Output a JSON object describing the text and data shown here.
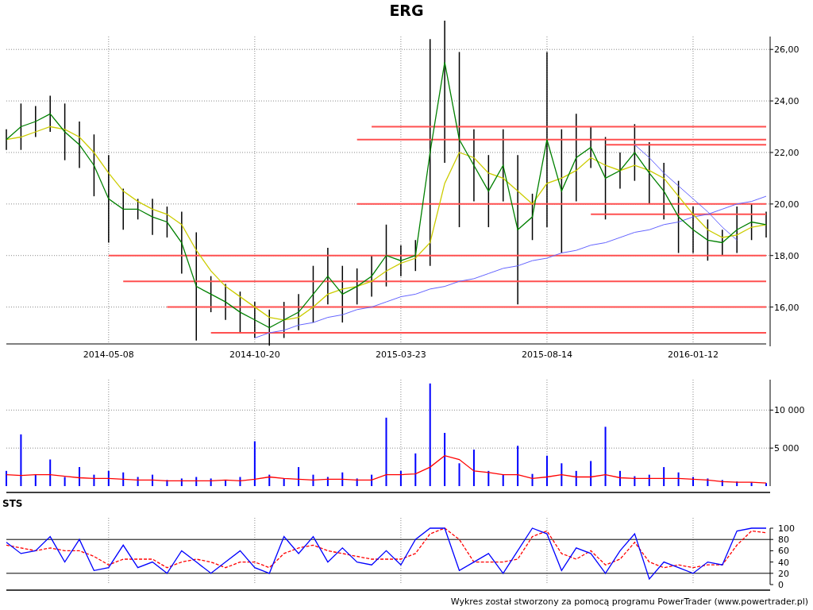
{
  "title": "ERG",
  "price_chart": {
    "chart_data": {
      "type": "line",
      "grid": true,
      "categories": [
        null,
        null,
        null,
        null,
        null,
        null,
        null,
        "2014-05-08",
        null,
        null,
        null,
        null,
        null,
        null,
        null,
        null,
        null,
        "2014-10-20",
        null,
        null,
        null,
        null,
        null,
        null,
        null,
        null,
        null,
        "2015-03-23",
        null,
        null,
        null,
        null,
        null,
        null,
        null,
        null,
        null,
        "2015-08-14",
        null,
        null,
        null,
        null,
        null,
        null,
        null,
        null,
        null,
        "2016-01-12",
        null,
        null,
        null,
        null,
        null
      ],
      "ylim": [
        14.6,
        26.5
      ],
      "yticks": [
        {
          "value": 16,
          "label": "16,00"
        },
        {
          "value": 18,
          "label": "18,00"
        },
        {
          "value": 20,
          "label": "20,00"
        },
        {
          "value": 22,
          "label": "22,00"
        },
        {
          "value": 24,
          "label": "24,00"
        },
        {
          "value": 26,
          "label": "26,00"
        }
      ],
      "series": [
        {
          "color": "#008000",
          "values": [
            22.5,
            23,
            23.2,
            23.5,
            22.8,
            22.3,
            21.5,
            20.2,
            19.8,
            19.8,
            19.5,
            19.3,
            18.5,
            16.8,
            16.5,
            16.2,
            15.8,
            15.5,
            15.2,
            15.5,
            15.8,
            16.5,
            17.2,
            16.5,
            16.8,
            17.2,
            18,
            17.8,
            18,
            22,
            25.5,
            22.5,
            21.5,
            20.5,
            21.5,
            19,
            19.5,
            22.5,
            20.5,
            21.8,
            22.2,
            21,
            21.3,
            22,
            21.2,
            20.5,
            19.5,
            19,
            18.6,
            18.5,
            19,
            19.3,
            19.2
          ],
          "errors": [
            0.4,
            0.9,
            0.6,
            0.7,
            1.1,
            0.9,
            1.2,
            1.7,
            0.8,
            0.4,
            0.7,
            0.6,
            1.2,
            2.1,
            0.7,
            0.7,
            0.8,
            0.7,
            0.7,
            0.7,
            0.7,
            1.1,
            1.1,
            1.1,
            0.7,
            0.8,
            1.2,
            0.6,
            0.6,
            4.4,
            3.9,
            3.4,
            1.4,
            1.4,
            1.4,
            2.9,
            0.9,
            3.4,
            2.4,
            1.7,
            0.8,
            1.6,
            0.7,
            1.1,
            1.2,
            1.1,
            1.4,
            0.9,
            0.8,
            0.5,
            0.9,
            0.7,
            0.5
          ]
        },
        {
          "color": "#cccc00",
          "values": [
            22.5,
            22.6,
            22.8,
            23,
            22.9,
            22.6,
            22,
            21.2,
            20.5,
            20.1,
            19.8,
            19.6,
            19.2,
            18.2,
            17.4,
            16.8,
            16.4,
            16,
            15.6,
            15.5,
            15.6,
            16,
            16.5,
            16.7,
            16.8,
            17,
            17.4,
            17.7,
            17.9,
            18.5,
            20.8,
            22,
            21.8,
            21.2,
            21,
            20.5,
            20,
            20.8,
            21,
            21.3,
            21.8,
            21.5,
            21.3,
            21.5,
            21.3,
            21,
            20.3,
            19.6,
            19,
            18.7,
            18.8,
            19.1,
            19.2
          ]
        },
        {
          "color": "#ff5050",
          "values": [
            null,
            null,
            null,
            null,
            null,
            null,
            null,
            null,
            null,
            null,
            null,
            null,
            null,
            null,
            null,
            null,
            null,
            null,
            null,
            null,
            null,
            null,
            null,
            null,
            null,
            23,
            23,
            23,
            23,
            23,
            23,
            23,
            23,
            23,
            23,
            23,
            23,
            23,
            23,
            23,
            23,
            23,
            23,
            23,
            23,
            23,
            23,
            23,
            23,
            23,
            23,
            23,
            23
          ]
        },
        {
          "color": "#ff5050",
          "values": [
            null,
            null,
            null,
            null,
            null,
            null,
            null,
            null,
            null,
            null,
            null,
            null,
            null,
            null,
            null,
            null,
            null,
            null,
            null,
            null,
            null,
            null,
            null,
            null,
            22.5,
            22.5,
            22.5,
            22.5,
            22.5,
            22.5,
            22.5,
            22.5,
            22.5,
            22.5,
            22.5,
            22.5,
            22.5,
            22.5,
            22.5,
            22.5,
            22.5,
            22.5,
            22.5,
            22.5,
            22.5,
            22.5,
            22.5,
            22.5,
            22.5,
            22.5,
            22.5,
            22.5,
            22.5
          ]
        },
        {
          "color": "#ff5050",
          "values": [
            null,
            null,
            null,
            null,
            null,
            null,
            null,
            null,
            null,
            null,
            null,
            null,
            null,
            null,
            null,
            null,
            null,
            null,
            null,
            null,
            null,
            null,
            null,
            null,
            null,
            null,
            null,
            null,
            null,
            null,
            null,
            null,
            null,
            null,
            null,
            null,
            null,
            null,
            null,
            null,
            null,
            22.3,
            22.3,
            22.3,
            22.3,
            22.3,
            22.3,
            22.3,
            22.3,
            22.3,
            22.3,
            22.3,
            22.3
          ]
        },
        {
          "color": "#ff5050",
          "values": [
            null,
            null,
            null,
            null,
            null,
            null,
            null,
            null,
            null,
            null,
            null,
            null,
            null,
            null,
            null,
            null,
            null,
            null,
            null,
            null,
            null,
            null,
            null,
            null,
            20,
            20,
            20,
            20,
            20,
            20,
            20,
            20,
            20,
            20,
            20,
            20,
            20,
            20,
            20,
            20,
            20,
            20,
            20,
            20,
            20,
            20,
            20,
            20,
            20,
            20,
            20,
            20,
            20
          ]
        },
        {
          "color": "#ff5050",
          "values": [
            null,
            null,
            null,
            null,
            null,
            null,
            null,
            null,
            null,
            null,
            null,
            null,
            null,
            null,
            null,
            null,
            null,
            null,
            null,
            null,
            null,
            null,
            null,
            null,
            null,
            null,
            null,
            null,
            null,
            null,
            null,
            null,
            null,
            null,
            null,
            null,
            null,
            null,
            null,
            null,
            19.6,
            19.6,
            19.6,
            19.6,
            19.6,
            19.6,
            19.6,
            19.6,
            19.6,
            19.6,
            19.6,
            19.6,
            19.6
          ]
        },
        {
          "color": "#ff5050",
          "values": [
            null,
            null,
            null,
            null,
            null,
            null,
            null,
            18,
            18,
            18,
            18,
            18,
            18,
            18,
            18,
            18,
            18,
            18,
            18,
            18,
            18,
            18,
            18,
            18,
            18,
            18,
            18,
            18,
            18,
            18,
            18,
            18,
            18,
            18,
            18,
            18,
            18,
            18,
            18,
            18,
            18,
            18,
            18,
            18,
            18,
            18,
            18,
            18,
            18,
            18,
            18,
            18,
            18
          ]
        },
        {
          "color": "#ff5050",
          "values": [
            null,
            null,
            null,
            null,
            null,
            null,
            null,
            null,
            17,
            17,
            17,
            17,
            17,
            17,
            17,
            17,
            17,
            17,
            17,
            17,
            17,
            17,
            17,
            17,
            17,
            17,
            17,
            17,
            17,
            17,
            17,
            17,
            17,
            17,
            17,
            17,
            17,
            17,
            17,
            17,
            17,
            17,
            17,
            17,
            17,
            17,
            17,
            17,
            17,
            17,
            17,
            17,
            17
          ]
        },
        {
          "color": "#ff5050",
          "values": [
            null,
            null,
            null,
            null,
            null,
            null,
            null,
            null,
            null,
            null,
            null,
            16,
            16,
            16,
            16,
            16,
            16,
            16,
            16,
            16,
            16,
            16,
            16,
            16,
            16,
            16,
            16,
            16,
            16,
            16,
            16,
            16,
            16,
            16,
            16,
            16,
            16,
            16,
            16,
            16,
            16,
            16,
            16,
            16,
            16,
            16,
            16,
            16,
            16,
            16,
            16,
            16,
            16
          ]
        },
        {
          "color": "#ff5050",
          "values": [
            null,
            null,
            null,
            null,
            null,
            null,
            null,
            null,
            null,
            null,
            null,
            null,
            null,
            null,
            15,
            15,
            15,
            15,
            15,
            15,
            15,
            15,
            15,
            15,
            15,
            15,
            15,
            15,
            15,
            15,
            15,
            15,
            15,
            15,
            15,
            15,
            15,
            15,
            15,
            15,
            15,
            15,
            15,
            15,
            15,
            15,
            15,
            15,
            15,
            15,
            15,
            15,
            15
          ]
        },
        {
          "color": "#6464ff",
          "values": [
            null,
            null,
            null,
            null,
            null,
            null,
            null,
            null,
            null,
            null,
            null,
            null,
            null,
            null,
            null,
            null,
            null,
            14.8,
            15,
            15.1,
            15.3,
            15.4,
            15.6,
            15.7,
            15.9,
            16,
            16.2,
            16.4,
            16.5,
            16.7,
            16.8,
            17,
            17.1,
            17.3,
            17.5,
            17.6,
            17.8,
            17.9,
            18.1,
            18.2,
            18.4,
            18.5,
            18.7,
            18.9,
            19,
            19.2,
            19.3,
            19.5,
            19.6,
            19.8,
            20,
            20.1,
            20.3
          ]
        },
        {
          "color": "#6464ff",
          "values": [
            null,
            null,
            null,
            null,
            null,
            null,
            null,
            null,
            null,
            null,
            null,
            null,
            null,
            null,
            null,
            null,
            null,
            null,
            null,
            null,
            null,
            null,
            null,
            null,
            null,
            null,
            null,
            null,
            null,
            null,
            null,
            null,
            null,
            null,
            null,
            null,
            null,
            null,
            null,
            null,
            null,
            null,
            null,
            22.3,
            21.8,
            21.2,
            20.7,
            20.2,
            19.7,
            19.1,
            18.6,
            null,
            null
          ]
        }
      ]
    }
  },
  "volume_chart": {
    "chart_data": {
      "type": "bar",
      "grid": true,
      "ylim": [
        0,
        14000
      ],
      "yticks": [
        {
          "value": 5000,
          "label": "5 000"
        },
        {
          "value": 10000,
          "label": "10 000"
        }
      ],
      "series": [
        {
          "type": "bar",
          "color": "#0000ff",
          "values": [
            2000,
            6800,
            1500,
            3500,
            1200,
            2500,
            1500,
            2000,
            1800,
            1200,
            1500,
            800,
            1000,
            1200,
            1000,
            800,
            1200,
            5900,
            1500,
            1000,
            2500,
            1500,
            1200,
            1800,
            1000,
            1500,
            9000,
            2000,
            4300,
            13500,
            7000,
            3000,
            4800,
            2000,
            1500,
            5300,
            1600,
            4000,
            3000,
            2000,
            3300,
            7800,
            2000,
            1300,
            1500,
            2500,
            1800,
            1200,
            1000,
            800,
            600,
            500,
            400
          ]
        },
        {
          "type": "line",
          "color": "#ff0000",
          "values": [
            1500,
            1400,
            1500,
            1500,
            1300,
            1100,
            1000,
            1000,
            900,
            800,
            800,
            700,
            700,
            700,
            700,
            800,
            700,
            900,
            1200,
            1000,
            900,
            800,
            900,
            900,
            800,
            800,
            1500,
            1500,
            1600,
            2500,
            4000,
            3500,
            2000,
            1800,
            1500,
            1500,
            1000,
            1200,
            1500,
            1200,
            1200,
            1500,
            1100,
            1000,
            1000,
            1000,
            1000,
            900,
            800,
            600,
            500,
            500,
            400
          ]
        }
      ]
    }
  },
  "sts_panel": {
    "label": "STS",
    "chart_data": {
      "type": "line",
      "grid": true,
      "ylim": [
        0,
        100
      ],
      "yticks": [
        0,
        20,
        40,
        60,
        80,
        100
      ],
      "ref_lines": [
        {
          "axis": "y",
          "value": 80
        },
        {
          "axis": "y",
          "value": 20
        }
      ],
      "series": [
        {
          "color": "#0000ff",
          "values": [
            75,
            55,
            60,
            85,
            40,
            80,
            25,
            30,
            70,
            30,
            40,
            20,
            60,
            40,
            20,
            40,
            60,
            30,
            20,
            85,
            55,
            85,
            40,
            65,
            40,
            35,
            60,
            35,
            80,
            100,
            100,
            25,
            40,
            55,
            20,
            60,
            100,
            90,
            25,
            65,
            55,
            20,
            60,
            90,
            10,
            40,
            30,
            20,
            40,
            35,
            95,
            100,
            100
          ]
        },
        {
          "color": "#ff0000",
          "line_style": "dashed",
          "values": [
            70,
            65,
            60,
            65,
            60,
            60,
            50,
            35,
            45,
            45,
            45,
            30,
            40,
            45,
            40,
            30,
            40,
            40,
            30,
            55,
            65,
            70,
            60,
            55,
            50,
            45,
            45,
            45,
            55,
            90,
            100,
            80,
            40,
            40,
            40,
            45,
            85,
            95,
            55,
            45,
            60,
            35,
            45,
            75,
            40,
            30,
            35,
            30,
            35,
            35,
            70,
            95,
            92
          ]
        }
      ]
    }
  },
  "footer": "Wykres został stworzony za pomocą programu PowerTrader (www.powertrader.pl)"
}
